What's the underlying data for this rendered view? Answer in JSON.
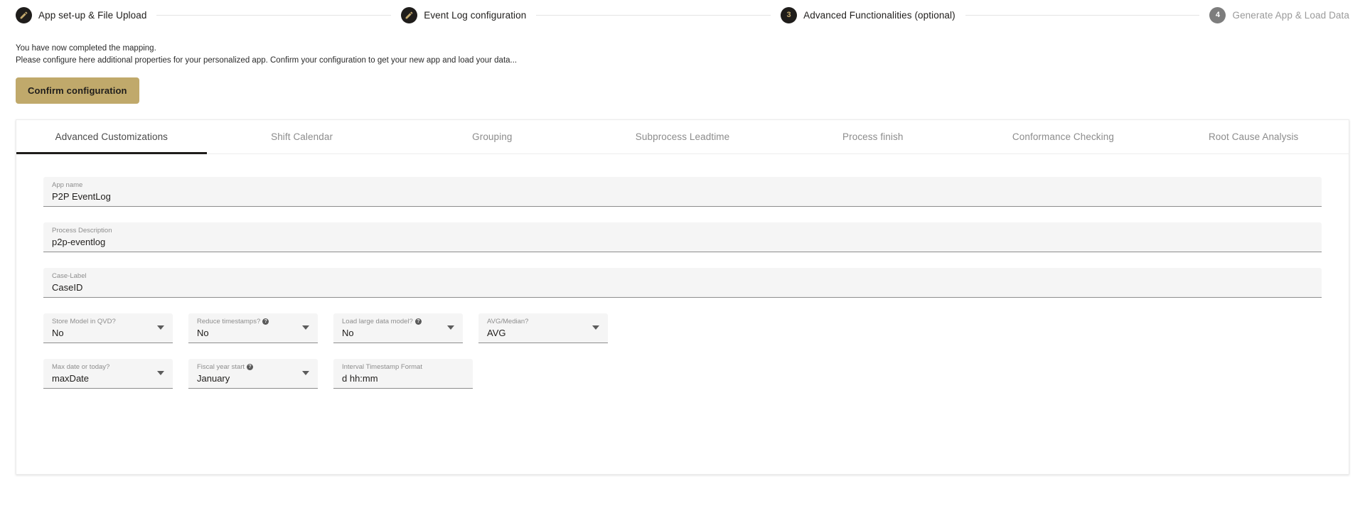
{
  "stepper": {
    "steps": [
      {
        "label": "App set-up & File Upload",
        "icon": "pencil-icon",
        "state": "done",
        "num": ""
      },
      {
        "label": "Event Log configuration",
        "icon": "pencil-icon",
        "state": "done",
        "num": ""
      },
      {
        "label": "Advanced Functionalities (optional)",
        "icon": "number",
        "state": "active",
        "num": "3"
      },
      {
        "label": "Generate App & Load Data",
        "icon": "number",
        "state": "inactive",
        "num": "4"
      }
    ]
  },
  "intro": {
    "line1": "You have now completed the mapping.",
    "line2": "Please configure here additional properties for your personalized app. Confirm your configuration to get your new app and load your data..."
  },
  "toolbar": {
    "confirm_label": "Confirm configuration"
  },
  "tabs": [
    {
      "label": "Advanced Customizations",
      "active": true
    },
    {
      "label": "Shift Calendar",
      "active": false
    },
    {
      "label": "Grouping",
      "active": false
    },
    {
      "label": "Subprocess Leadtime",
      "active": false
    },
    {
      "label": "Process finish",
      "active": false
    },
    {
      "label": "Conformance Checking",
      "active": false
    },
    {
      "label": "Root Cause Analysis",
      "active": false
    }
  ],
  "form": {
    "app_name": {
      "label": "App name",
      "value": "P2P EventLog"
    },
    "process_description": {
      "label": "Process Description",
      "value": "p2p-eventlog"
    },
    "case_label": {
      "label": "Case-Label",
      "value": "CaseID"
    },
    "store_model_qvd": {
      "label": "Store Model in QVD?",
      "value": "No",
      "help": false
    },
    "reduce_timestamps": {
      "label": "Reduce timestamps?",
      "value": "No",
      "help": true
    },
    "load_large_model": {
      "label": "Load large data model?",
      "value": "No",
      "help": true
    },
    "avg_median": {
      "label": "AVG/Median?",
      "value": "AVG",
      "help": false
    },
    "max_date_today": {
      "label": "Max date or today?",
      "value": "maxDate",
      "help": false
    },
    "fiscal_year_start": {
      "label": "Fiscal year start",
      "value": "January",
      "help": true
    },
    "interval_ts_format": {
      "label": "Interval Timestamp Format",
      "value": "d hh:mm",
      "help": false
    }
  },
  "colors": {
    "accent": "#c0a96b",
    "dark": "#1f1d1b",
    "field_bg": "#f5f5f5",
    "inactive": "#7d7d7d"
  }
}
